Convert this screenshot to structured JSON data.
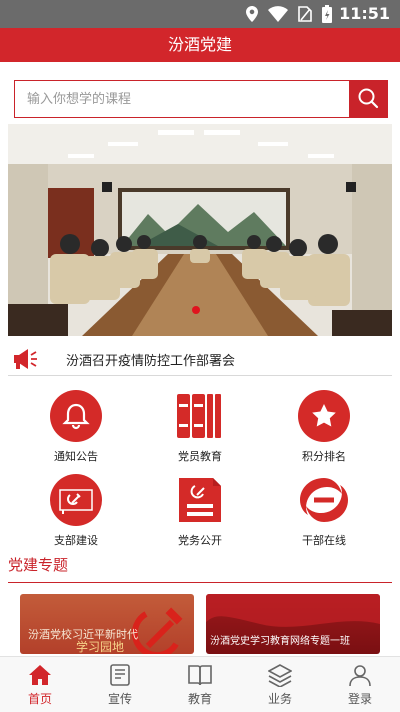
{
  "status_bar": {
    "time": "11:51"
  },
  "header": {
    "title": "汾酒党建"
  },
  "search": {
    "placeholder": "输入你想学的课程"
  },
  "banner": {
    "slides": 1,
    "active_index": 0
  },
  "news": {
    "headline": "汾酒召开疫情防控工作部署会"
  },
  "grid": {
    "items": [
      {
        "label": "通知公告",
        "icon": "bell-icon"
      },
      {
        "label": "党员教育",
        "icon": "books-icon"
      },
      {
        "label": "积分排名",
        "icon": "star-icon"
      },
      {
        "label": "支部建设",
        "icon": "party-emblem-icon"
      },
      {
        "label": "党务公开",
        "icon": "document-icon"
      },
      {
        "label": "干部在线",
        "icon": "swirl-icon"
      }
    ]
  },
  "section": {
    "title": "党建专题"
  },
  "cards": [
    {
      "text": "汾酒党校习近平新时代",
      "handwriting": "学习园地"
    },
    {
      "text": "汾酒党史学习教育网络专题一班"
    }
  ],
  "nav": {
    "items": [
      {
        "label": "首页",
        "icon": "home-icon",
        "active": true
      },
      {
        "label": "宣传",
        "icon": "news-icon",
        "active": false
      },
      {
        "label": "教育",
        "icon": "book-icon",
        "active": false
      },
      {
        "label": "业务",
        "icon": "layers-icon",
        "active": false
      },
      {
        "label": "登录",
        "icon": "user-icon",
        "active": false
      }
    ]
  },
  "colors": {
    "brand": "#d2262b",
    "accent": "#c9232a",
    "status_bar": "#6b6b6b"
  }
}
